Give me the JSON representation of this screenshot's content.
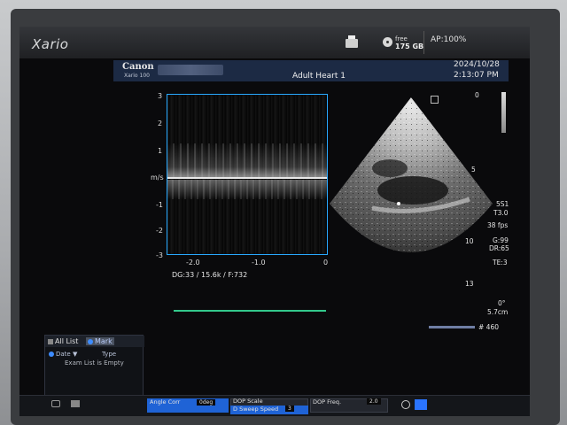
{
  "app": {
    "title": "Xario"
  },
  "topbar": {
    "free_label": "free",
    "free_value": "175 GB",
    "ap": "AP:100%"
  },
  "header": {
    "brand": "Canon",
    "model": "Xario 100",
    "exam": "Adult Heart 1",
    "date": "2024/10/28",
    "time": "2:13:07 PM"
  },
  "doppler": {
    "unit": "m/s",
    "y_ticks": [
      "3",
      "2",
      "1",
      "",
      "-1",
      "-2",
      "-3"
    ],
    "x_ticks": [
      "-2.0",
      "-1.0",
      "0"
    ],
    "params": "DG:33  / 15.6k  / F:732"
  },
  "bmode": {
    "depth_top": "0",
    "depth_marks": [
      "5",
      "10",
      "13"
    ],
    "probe": "5S1",
    "t": "T3.0",
    "fps": "38 fps",
    "gain": "G:99",
    "dr": "DR:65",
    "te": "TE:3",
    "angle": "0°",
    "depth": "5.7cm",
    "frame": "# 460"
  },
  "list": {
    "tab_all": "All List",
    "tab_mark": "Mark",
    "col_date": "Date",
    "col_type": "Type",
    "empty": "Exam List is Empty"
  },
  "bottom": {
    "angle_corr": "Angle Corr",
    "angle_val": "0deg",
    "dop_scale": "DOP Scale",
    "sweep": "D Sweep Speed",
    "sweep_val": "3",
    "dop_freq": "DOP Freq.",
    "dop_freq_val": "2.0"
  }
}
